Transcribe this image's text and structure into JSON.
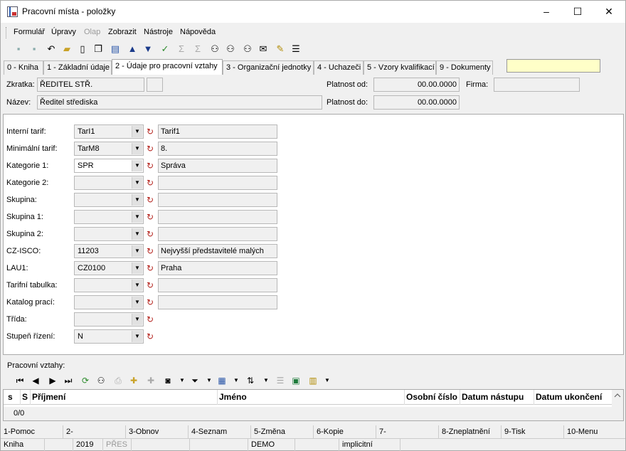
{
  "window": {
    "title": "Pracovní místa - položky",
    "minimize": "–",
    "maximize": "☐",
    "close": "✕"
  },
  "menu": [
    {
      "label": "Formulář",
      "disabled": false
    },
    {
      "label": "Úpravy",
      "disabled": false
    },
    {
      "label": "Olap",
      "disabled": true
    },
    {
      "label": "Zobrazit",
      "disabled": false
    },
    {
      "label": "Nástroje",
      "disabled": false
    },
    {
      "label": "Nápověda",
      "disabled": false
    }
  ],
  "tabs": [
    {
      "label": "0 - Kniha",
      "active": false
    },
    {
      "label": "1 - Základní údaje",
      "active": false
    },
    {
      "label": "2 - Údaje pro pracovní vztahy",
      "active": true
    },
    {
      "label": "3 - Organizační jednotky",
      "active": false
    },
    {
      "label": "4 - Uchazeči",
      "active": false
    },
    {
      "label": "5 - Vzory kvalifikací",
      "active": false
    },
    {
      "label": "9 - Dokumenty",
      "active": false
    }
  ],
  "header": {
    "zkratka_label": "Zkratka:",
    "zkratka_value": "ŘEDITEL STŘ.",
    "nazev_label": "Název:",
    "nazev_value": "Ředitel střediska",
    "platnost_od_label": "Platnost od:",
    "platnost_od_value": "00.00.0000",
    "platnost_do_label": "Platnost do:",
    "platnost_do_value": "00.00.0000",
    "firma_label": "Firma:",
    "firma_value": ""
  },
  "fields": [
    {
      "label": "Interní tarif:",
      "code": "TarI1",
      "desc": "Tarif1",
      "has_desc": true
    },
    {
      "label": "Minimální tarif:",
      "code": "TarM8",
      "desc": "8.",
      "has_desc": true
    },
    {
      "label": "Kategorie 1:",
      "code": "SPR",
      "desc": "Správa",
      "has_desc": true
    },
    {
      "label": "Kategorie 2:",
      "code": "",
      "desc": "",
      "has_desc": true
    },
    {
      "label": "Skupina:",
      "code": "",
      "desc": "",
      "has_desc": true
    },
    {
      "label": "Skupina 1:",
      "code": "",
      "desc": "",
      "has_desc": true
    },
    {
      "label": "Skupina 2:",
      "code": "",
      "desc": "",
      "has_desc": true
    },
    {
      "label": "CZ-ISCO:",
      "code": "11203",
      "desc": "Nejvyšší představitelé malých",
      "has_desc": true
    },
    {
      "label": "LAU1:",
      "code": "CZ0100",
      "desc": "Praha",
      "has_desc": true
    },
    {
      "label": "Tarifní tabulka:",
      "code": "",
      "desc": "",
      "has_desc": true
    },
    {
      "label": "Katalog prací:",
      "code": "",
      "desc": "",
      "has_desc": true
    },
    {
      "label": "Třída:",
      "code": "",
      "desc": "",
      "has_desc": false
    },
    {
      "label": "Stupeň řízení:",
      "code": "N",
      "desc": "",
      "has_desc": false
    }
  ],
  "relations": {
    "section_label": "Pracovní vztahy:",
    "columns": [
      "s",
      "S",
      "Příjmení",
      "Jméno",
      "Osobní číslo",
      "Datum nástupu",
      "Datum ukončení"
    ],
    "count": "0/0"
  },
  "fkeys": [
    "1-Pomoc",
    "2-",
    "3-Obnov",
    "4-Seznam",
    "5-Změna",
    "6-Kopie",
    "7-",
    "8-Zneplatnění",
    "9-Tisk",
    "10-Menu"
  ],
  "status": {
    "module": "Kniha",
    "blank1": "",
    "year": "2019",
    "pres": "PŘES",
    "blank2": "",
    "blank3": "",
    "db": "DEMO",
    "blank4": "",
    "mode": "implicitní",
    "blank5": ""
  }
}
